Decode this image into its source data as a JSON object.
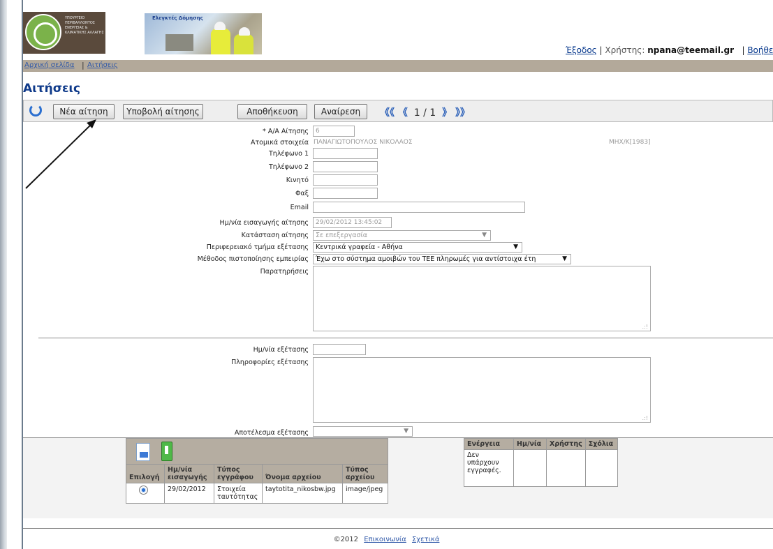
{
  "header": {
    "logo1_text": "ΥΠΟΥΡΓΕΙΟ ΠΕΡΙΒΑΛΛΟΝΤΟΣ ΕΝΕΡΓΕΙΑΣ & ΚΛΙΜΑΤΙΚΗΣ ΑΛΛΑΓΗΣ",
    "logo2_text": "Ελεγκτές Δόμησης",
    "exit_link": "Έξοδος",
    "sep1": "|",
    "user_label": "Χρήστης:",
    "user_email": "npana@teemail.gr",
    "sep2": "|",
    "help_link": "Βοήθεια"
  },
  "nav": {
    "home": "Αρχική σελίδα",
    "sep": "|",
    "applications": "Αιτήσεις"
  },
  "page_title": "Αιτήσεις",
  "toolbar": {
    "new_label": "Νέα αίτηση",
    "submit_label": "Υποβολή αίτησης",
    "save_label": "Αποθήκευση",
    "delete_label": "Αναίρεση",
    "first": "《《",
    "prev": "《",
    "page": "1 / 1",
    "next": "》",
    "last": "》》"
  },
  "form": {
    "aa_label": "* Α/Α Αίτησης",
    "aa_value": "6",
    "personal_label": "Ατομικά στοιχεία",
    "personal_name": "ΠΑΝΑΓΙΩΤΟΠΟΥΛΟΣ ΝΙΚΟΛΑΟΣ",
    "personal_code": "ΜΗΧ/Κ[1983]",
    "phone1_label": "Τηλέφωνο 1",
    "phone2_label": "Τηλέφωνο 2",
    "mobile_label": "Κινητό",
    "fax_label": "Φαξ",
    "email_label": "Email",
    "date_label": "Ημ/νία εισαγωγής αίτησης",
    "date_value": "29/02/2012  13:45:02",
    "status_label": "Κατάσταση αίτησης",
    "status_value": "Σε επεξεργασία",
    "region_label": "Περιφερειακό τμήμα εξέτασης",
    "region_value": "Κεντρικά γραφεία - Αθήνα",
    "method_label": "Μέθοδος πιστοποίησης εμπειρίας",
    "method_value": "Έχω στο σύστημα αμοιβών του ΤΕΕ πληρωμές για αντίστοιχα έτη",
    "notes_label": "Παρατηρήσεις",
    "exam_date_label": "Ημ/νία εξέτασης",
    "exam_info_label": "Πληροφορίες εξέτασης",
    "exam_result_label": "Αποτέλεσμα εξέτασης"
  },
  "files": {
    "headers": [
      "Επιλογή",
      "Ημ/νία εισαγωγής",
      "Τύπος εγγράφου",
      "Όνομα αρχείου",
      "Τύπος αρχείου"
    ],
    "rows": [
      {
        "date": "29/02/2012",
        "doc_type": "Στοιχεία ταυτότητας",
        "file_name": "taytotita_nikosbw.jpg",
        "file_type": "image/jpeg"
      }
    ]
  },
  "actions": {
    "headers": [
      "Ενέργεια",
      "Ημ/νία",
      "Χρήστης",
      "Σχόλια"
    ],
    "empty_text": "Δεν υπάρχουν εγγραφές."
  },
  "footer": {
    "copyright": "©2012",
    "contact": "Επικοινωνία",
    "about": "Σχετικά"
  },
  "colors": {
    "accent": "#0f3a8a",
    "nav_bg": "#b3a99a",
    "table_header_bg": "#b5ada1",
    "link": "#2f58a8"
  }
}
